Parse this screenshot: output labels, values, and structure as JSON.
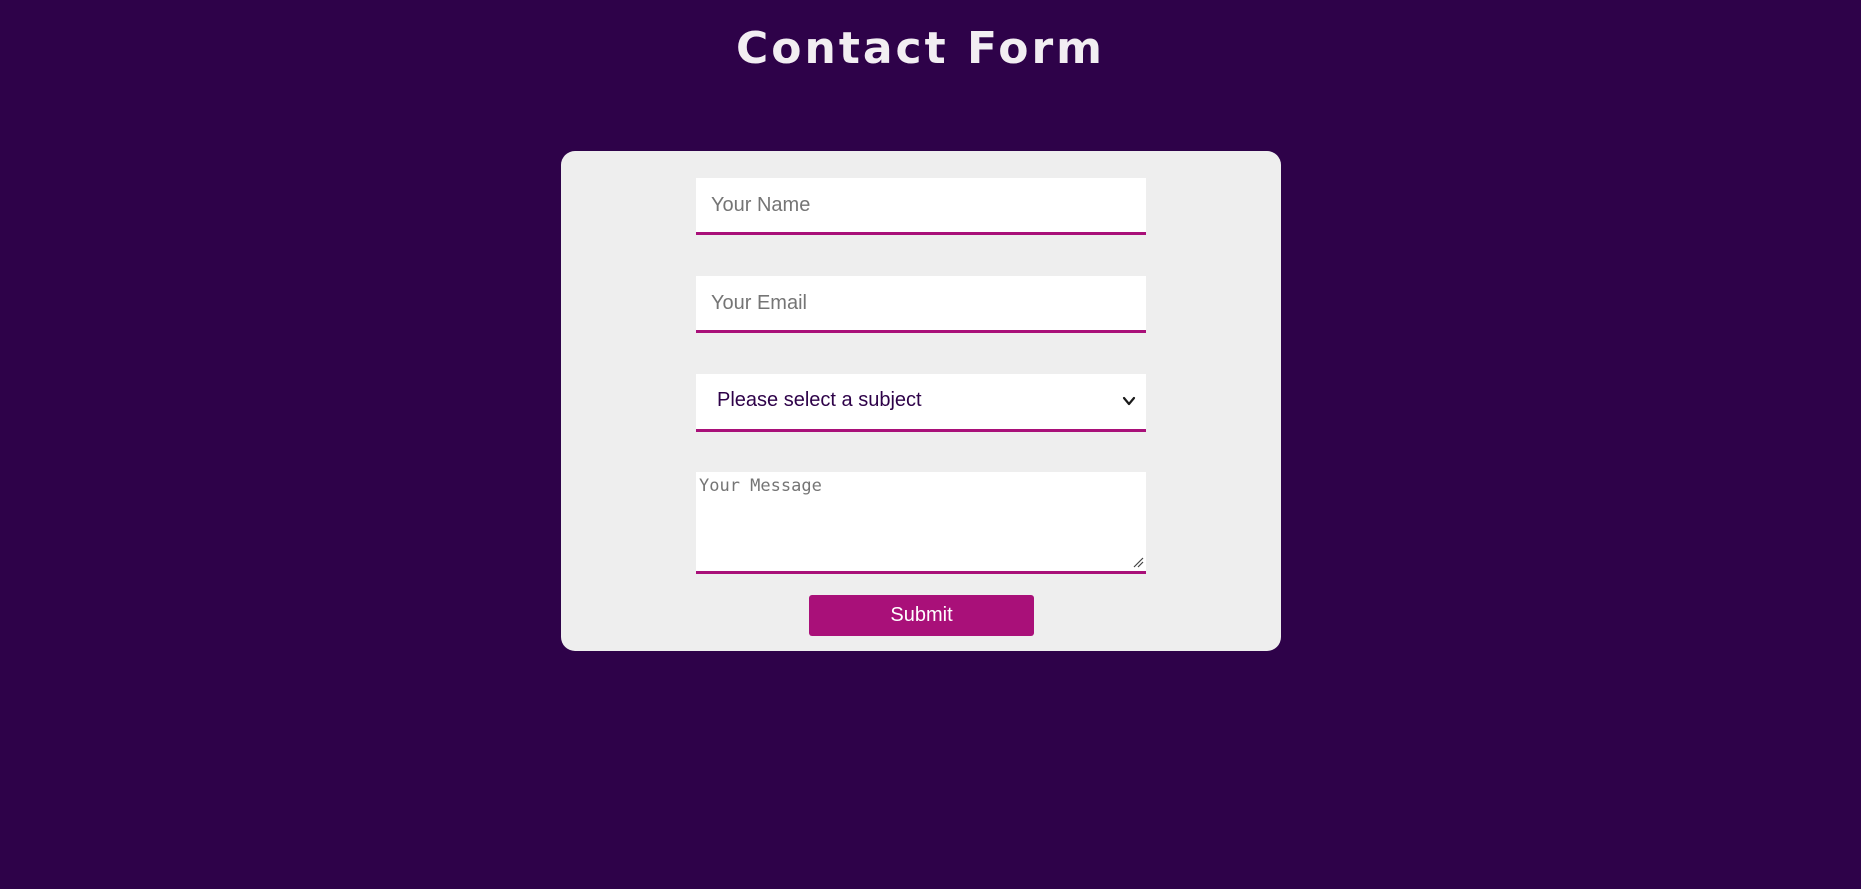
{
  "page": {
    "title": "Contact Form"
  },
  "form": {
    "name": {
      "placeholder": "Your Name",
      "value": ""
    },
    "email": {
      "placeholder": "Your Email",
      "value": ""
    },
    "subject": {
      "selected": "Please select a subject",
      "icon": "chevron-down-icon"
    },
    "message": {
      "placeholder": "Your Message",
      "value": ""
    },
    "submit_label": "Submit"
  },
  "colors": {
    "background": "#2e0249",
    "card": "#eeeeee",
    "accent": "#a91079",
    "title_text": "#f2eef2",
    "input_text": "#2e0249"
  }
}
